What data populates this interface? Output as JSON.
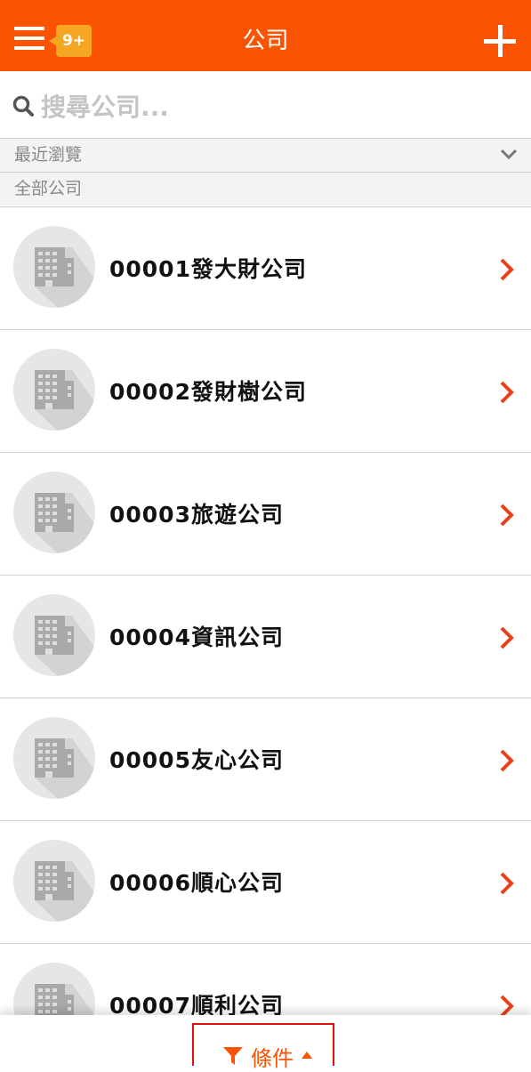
{
  "header": {
    "title": "公司",
    "badge": "9+",
    "accent_color": "#fb5304",
    "menu_icon": "hamburger-menu-icon",
    "add_icon": "plus-icon"
  },
  "search": {
    "placeholder": "搜尋公司...",
    "icon": "search-icon"
  },
  "sections": {
    "recent_label": "最近瀏覽",
    "recent_icon": "chevron-down-icon",
    "all_label": "全部公司"
  },
  "companies": [
    {
      "name": "00001發大財公司"
    },
    {
      "name": "00002發財樹公司"
    },
    {
      "name": "00003旅遊公司"
    },
    {
      "name": "00004資訊公司"
    },
    {
      "name": "00005友心公司"
    },
    {
      "name": "00006順心公司"
    },
    {
      "name": "00007順利公司"
    }
  ],
  "row_icons": {
    "avatar": "building-icon",
    "arrow": "chevron-right-icon",
    "arrow_color": "#e8401a"
  },
  "footer": {
    "filter_label": "條件",
    "filter_icon": "funnel-icon",
    "caret_icon": "caret-up-icon",
    "highlight_color": "#e10e0e"
  }
}
